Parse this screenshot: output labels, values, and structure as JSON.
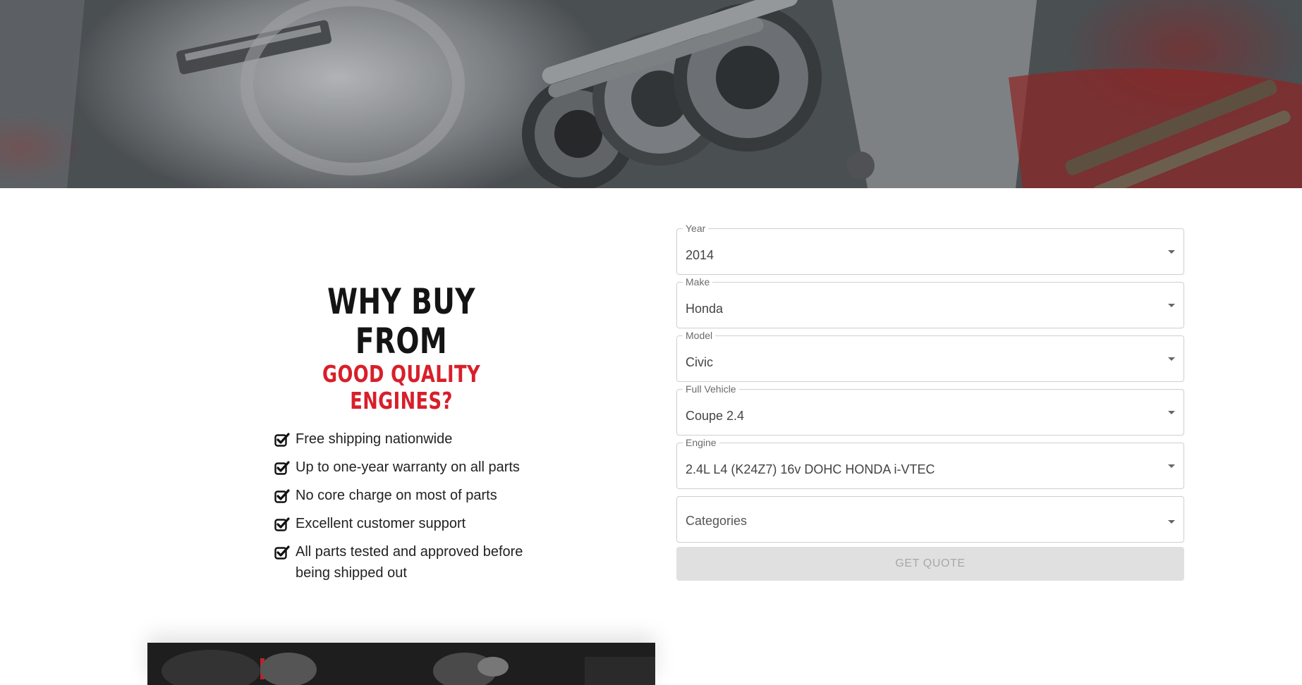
{
  "hero": {
    "image": "transmission-gearbox-photo"
  },
  "why": {
    "title_line1": "WHY BUY FROM",
    "title_line2": "GOOD QUALITY ENGINES?",
    "accent_color": "#d81f2a",
    "benefits": [
      "Free shipping nationwide",
      "Up to one-year warranty on all parts",
      "No core charge on most of parts",
      "Excellent customer support",
      "All parts tested and approved before being shipped out"
    ],
    "benefit_icon": "checkbox-checked-icon"
  },
  "form": {
    "year": {
      "label": "Year",
      "value": "2014"
    },
    "make": {
      "label": "Make",
      "value": "Honda"
    },
    "model": {
      "label": "Model",
      "value": "Civic"
    },
    "full_vehicle": {
      "label": "Full Vehicle",
      "value": "Coupe 2.4"
    },
    "engine": {
      "label": "Engine",
      "value": "2.4L L4 (K24Z7) 16v DOHC HONDA i-VTEC"
    },
    "categories": {
      "placeholder": "Categories"
    },
    "submit_label": "GET QUOTE",
    "submit_disabled": true
  },
  "bottom": {
    "image": "engine-bay-photo"
  }
}
